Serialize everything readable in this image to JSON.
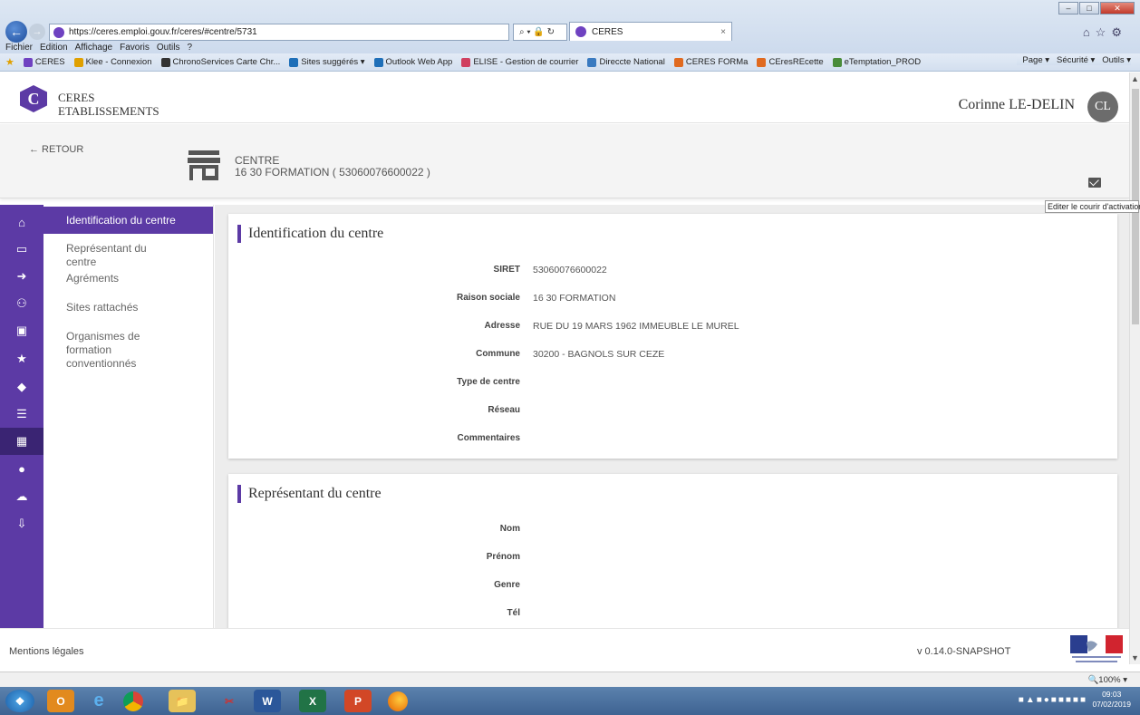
{
  "browser": {
    "url": "https://ceres.emploi.gouv.fr/ceres/#centre/5731",
    "address_tools": "⌕ ▾ 🔒 ↻",
    "tab_title": "CERES",
    "tab_close": "×",
    "menu": [
      "Fichier",
      "Edition",
      "Affichage",
      "Favoris",
      "Outils",
      "?"
    ],
    "favorites": [
      {
        "label": "CERES",
        "color": "#6f42c1"
      },
      {
        "label": "Klee - Connexion",
        "color": "#e0a000"
      },
      {
        "label": "ChronoServices Carte Chr...",
        "color": "#333333"
      },
      {
        "label": "Sites suggérés ▾",
        "color": "#1f6fb8"
      },
      {
        "label": "Outlook Web App",
        "color": "#1f6fb8"
      },
      {
        "label": "ELISE - Gestion de courrier",
        "color": "#d04060"
      },
      {
        "label": "Direccte National",
        "color": "#3a7ac0"
      },
      {
        "label": "CERES FORMa",
        "color": "#e06a20"
      },
      {
        "label": "CEresREcette",
        "color": "#e06a20"
      },
      {
        "label": "eTemptation_PROD",
        "color": "#4a8c3a"
      }
    ],
    "command_bar": [
      "Page ▾",
      "Sécurité ▾",
      "Outils ▾"
    ],
    "zoom": "🔍100%  ▾"
  },
  "app": {
    "logo_letter": "C",
    "title_line1": "CERES",
    "title_line2": "ETABLISSEMENTS",
    "user_name": "Corinne LE-DELIN",
    "user_initials": "CL"
  },
  "subheader": {
    "back_label": "←  RETOUR",
    "entity_type": "CENTRE",
    "entity_name": "16 30 FORMATION ( 53060076600022 )",
    "mail_tooltip": "Editer le courir d'activation"
  },
  "side_nav": [
    {
      "label": "Identification du centre",
      "active": true
    },
    {
      "label": "Représentant du centre",
      "active": false
    },
    {
      "label": "Agréments",
      "active": false
    },
    {
      "label": "Sites rattachés",
      "active": false
    },
    {
      "label": "Organismes de formation conventionnés",
      "active": false
    }
  ],
  "rail_icons": [
    "home-icon",
    "monitor-icon",
    "sign-in-icon",
    "users-icon",
    "contact-card-icon",
    "folder-star-icon",
    "graduation-cap-icon",
    "clipboard-icon",
    "building-icon",
    "user-circle-icon",
    "cloud-upload-icon",
    "clipboard-download-icon"
  ],
  "identification": {
    "title": "Identification du centre",
    "rows": [
      {
        "label": "SIRET",
        "value": "53060076600022"
      },
      {
        "label": "Raison sociale",
        "value": "16 30 FORMATION"
      },
      {
        "label": "Adresse",
        "value": "RUE DU 19 MARS 1962 IMMEUBLE LE MUREL"
      },
      {
        "label": "Commune",
        "value": "30200 - BAGNOLS SUR CEZE"
      },
      {
        "label": "Type de centre",
        "value": ""
      },
      {
        "label": "Réseau",
        "value": ""
      },
      {
        "label": "Commentaires",
        "value": ""
      }
    ]
  },
  "representant": {
    "title": "Représentant du centre",
    "rows": [
      {
        "label": "Nom",
        "value": ""
      },
      {
        "label": "Prénom",
        "value": ""
      },
      {
        "label": "Genre",
        "value": ""
      },
      {
        "label": "Tél",
        "value": ""
      }
    ]
  },
  "footer": {
    "mentions": "Mentions légales",
    "version": "v 0.14.0-SNAPSHOT"
  },
  "taskbar": {
    "time": "09:03",
    "date": "07/02/2019"
  }
}
